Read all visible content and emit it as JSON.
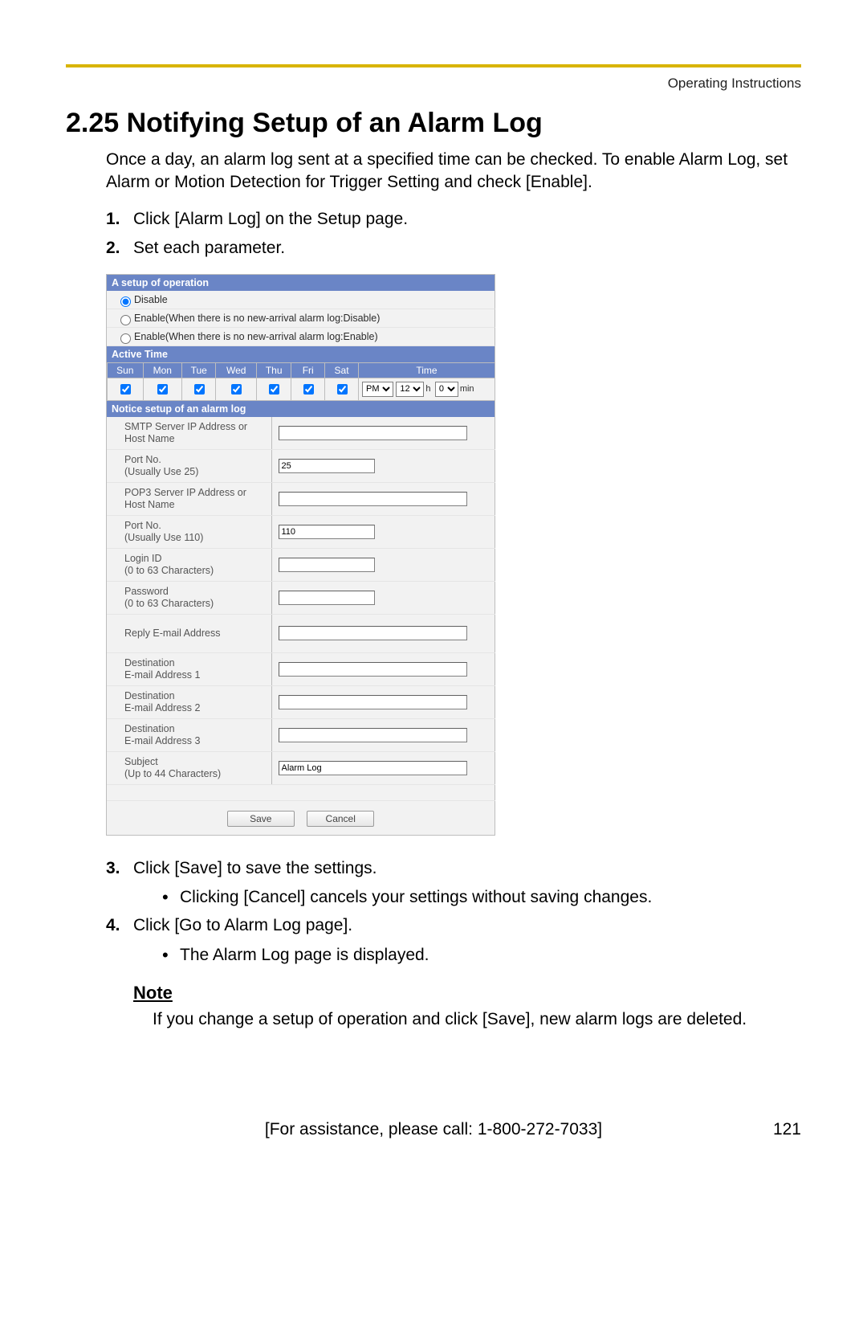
{
  "header": {
    "running": "Operating Instructions",
    "title": "2.25  Notifying Setup of an Alarm Log"
  },
  "intro": "Once a day, an alarm log sent at a specified time can be checked. To enable Alarm Log, set Alarm or Motion Detection for Trigger Setting and check [Enable].",
  "steps": {
    "s1": {
      "num": "1.",
      "text": "Click [Alarm Log] on the Setup page."
    },
    "s2": {
      "num": "2.",
      "text": "Set each parameter."
    },
    "s3": {
      "num": "3.",
      "text": "Click [Save] to save the settings.",
      "bullet": "Clicking [Cancel] cancels your settings without saving changes."
    },
    "s4": {
      "num": "4.",
      "text": "Click [Go to Alarm Log page].",
      "bullet": "The Alarm Log page is displayed."
    }
  },
  "note": {
    "heading": "Note",
    "body": "If you change a setup of operation and click [Save], new alarm logs are deleted."
  },
  "footer": {
    "assist": "[For assistance, please call: 1-800-272-7033]",
    "page": "121"
  },
  "ui": {
    "setup_header": "A setup of operation",
    "opt_disable": "Disable",
    "opt_enable_disable": "Enable(When there is no new-arrival alarm log:Disable)",
    "opt_enable_enable": "Enable(When there is no new-arrival alarm log:Enable)",
    "active_time_header": "Active Time",
    "days": {
      "sun": "Sun",
      "mon": "Mon",
      "tue": "Tue",
      "wed": "Wed",
      "thu": "Thu",
      "fri": "Fri",
      "sat": "Sat",
      "time": "Time"
    },
    "time": {
      "ampm_selected": "PM",
      "hour_selected": "12",
      "min_selected": "0",
      "h_label": "h",
      "min_label": "min"
    },
    "notice_header": "Notice setup of an alarm log",
    "fields": {
      "smtp": "SMTP Server IP Address or Host Name",
      "smtp_port_label": "Port No.\n(Usually Use 25)",
      "smtp_port_value": "25",
      "pop3": "POP3 Server IP Address or Host Name",
      "pop3_port_label": "Port No.\n(Usually Use 110)",
      "pop3_port_value": "110",
      "login": "Login ID\n(0 to 63 Characters)",
      "password": "Password\n(0 to 63 Characters)",
      "reply": "Reply E-mail Address",
      "dest1": "Destination\nE-mail Address 1",
      "dest2": "Destination\nE-mail Address 2",
      "dest3": "Destination\nE-mail Address 3",
      "subject_label": "Subject\n(Up to 44 Characters)",
      "subject_value": "Alarm Log"
    },
    "buttons": {
      "save": "Save",
      "cancel": "Cancel"
    }
  }
}
